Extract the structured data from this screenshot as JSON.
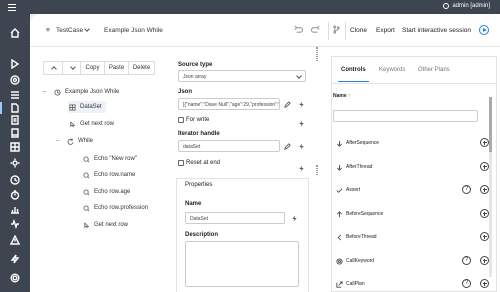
{
  "topbar": {
    "user": "admin [admin]"
  },
  "header": {
    "type": "TestCase",
    "name": "Example Json While",
    "clone": "Clone",
    "export": "Export",
    "start": "Start interactive session"
  },
  "toolbar": {
    "copy": "Copy",
    "paste": "Paste",
    "delete": "Delete"
  },
  "tree": {
    "root": "Example Json While",
    "dataset": "DataSet",
    "get_next_row": "Get next row",
    "while": "While",
    "children": [
      "Echo \"New row\"",
      "Echo row.name",
      "Echo row.age",
      "Echo row.profession",
      "Get next row"
    ]
  },
  "props": {
    "source_type_label": "Source type",
    "source_type_value": "Json array",
    "json_label": "Json",
    "json_value": "[{\"name\":\"Dave Null\",\"age\":29,\"profession\":\"Developer\"}]",
    "for_write": "For write",
    "iterator_label": "Iterator handle",
    "iterator_value": "dataSet",
    "reset_at_end": "Reset at end",
    "properties_title": "Properties",
    "name_label": "Name",
    "name_value": "DataSet",
    "description_label": "Description"
  },
  "right": {
    "tabs": [
      "Controls",
      "Keywords",
      "Other Plans"
    ],
    "sort_label": "Name",
    "items": [
      "AfterSequence",
      "AfterThread",
      "Assert",
      "BeforeSequence",
      "BeforeThread",
      "CallKeyword",
      "CallPlan"
    ]
  }
}
